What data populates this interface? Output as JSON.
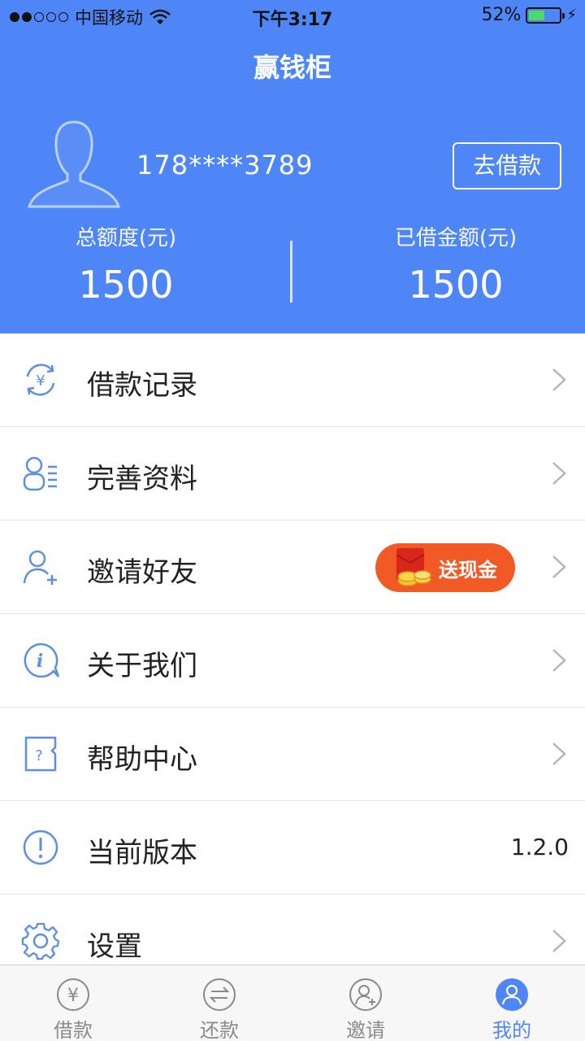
{
  "status_bar": {
    "carrier": "中国移动",
    "time": "下午3:17",
    "battery_percent": "52%",
    "battery_level": 0.52
  },
  "header": {
    "title": "赢钱柜",
    "phone": "178****3789",
    "borrow_button": "去借款",
    "total_credit_label": "总额度(元)",
    "total_credit_value": "1500",
    "borrowed_label": "已借金额(元)",
    "borrowed_value": "1500"
  },
  "menu": {
    "items": [
      {
        "label": "借款记录",
        "icon": "yen-cycle-icon"
      },
      {
        "label": "完善资料",
        "icon": "profile-list-icon"
      },
      {
        "label": "邀请好友",
        "icon": "add-user-icon",
        "badge": "送现金"
      },
      {
        "label": "关于我们",
        "icon": "info-bubble-icon"
      },
      {
        "label": "帮助中心",
        "icon": "help-doc-icon"
      },
      {
        "label": "当前版本",
        "icon": "exclamation-icon",
        "value": "1.2.0"
      },
      {
        "label": "设置",
        "icon": "gear-icon"
      }
    ]
  },
  "tabbar": {
    "tabs": [
      {
        "label": "借款",
        "icon": "yen-icon"
      },
      {
        "label": "还款",
        "icon": "arrows-swap-icon"
      },
      {
        "label": "邀请",
        "icon": "invite-user-icon"
      },
      {
        "label": "我的",
        "icon": "user-icon",
        "active": true
      }
    ]
  },
  "colors": {
    "primary": "#4f86f7",
    "promo": "#f25a25",
    "icon_blue": "#5b8fe6"
  }
}
